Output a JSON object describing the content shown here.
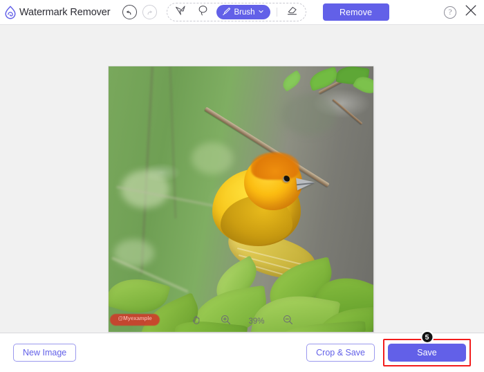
{
  "app": {
    "title": "Watermark Remover",
    "logo_icon": "water-drop-logo",
    "accent_color": "#6260e8",
    "highlight_color": "#f21c1c"
  },
  "header": {
    "history": [
      {
        "name": "undo",
        "icon": "undo-arrow-icon",
        "state": "enabled"
      },
      {
        "name": "redo",
        "icon": "redo-arrow-icon",
        "state": "disabled"
      }
    ],
    "tools": [
      {
        "name": "polygonal-lasso",
        "icon": "polygonal-lasso-icon",
        "label": "",
        "active": false
      },
      {
        "name": "lasso",
        "icon": "lasso-icon",
        "label": "",
        "active": false
      },
      {
        "name": "brush",
        "icon": "brush-icon",
        "label": "Brush",
        "active": true,
        "caret": "chevron-down-icon"
      },
      {
        "name": "eraser",
        "icon": "eraser-icon",
        "label": "",
        "active": false
      }
    ],
    "remove_label": "Remove",
    "help_label": "?",
    "close_icon": "close-x-icon"
  },
  "canvas": {
    "image_alt": "yellow weaver bird perched on branch with green leaves",
    "watermark_text": "@Myexample",
    "watermark_selected": true
  },
  "zoombar": {
    "hand_icon": "hand-tool-icon",
    "zoom_in_icon": "zoom-in-icon",
    "zoom_out_icon": "zoom-out-icon",
    "zoom_level": "39%"
  },
  "footer": {
    "new_image_label": "New Image",
    "crop_save_label": "Crop & Save",
    "save_label": "Save",
    "step_badge": "5"
  }
}
